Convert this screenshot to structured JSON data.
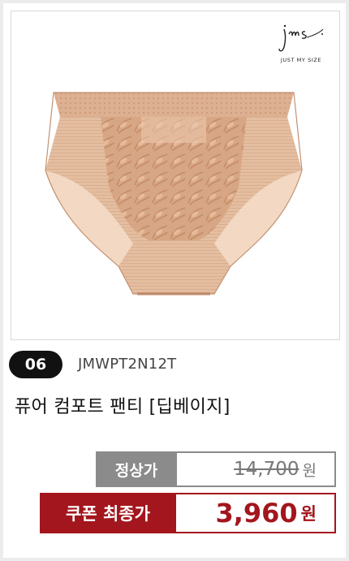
{
  "brand": {
    "script": "jms",
    "tagline": "JUST MY SIZE"
  },
  "product": {
    "number": "06",
    "code": "JMWPT2N12T",
    "name": "퓨어 컴포트 팬티 [딥베이지]"
  },
  "pricing": {
    "regular_label": "정상가",
    "regular_price": "14,700",
    "regular_unit": "원",
    "coupon_label": "쿠폰 최종가",
    "coupon_price": "3,960",
    "coupon_unit": "원"
  },
  "colors": {
    "badge": "#111111",
    "regular_gray": "#8b8b8b",
    "coupon_red": "#a3161d",
    "product_beige": "#d8ad8d"
  }
}
